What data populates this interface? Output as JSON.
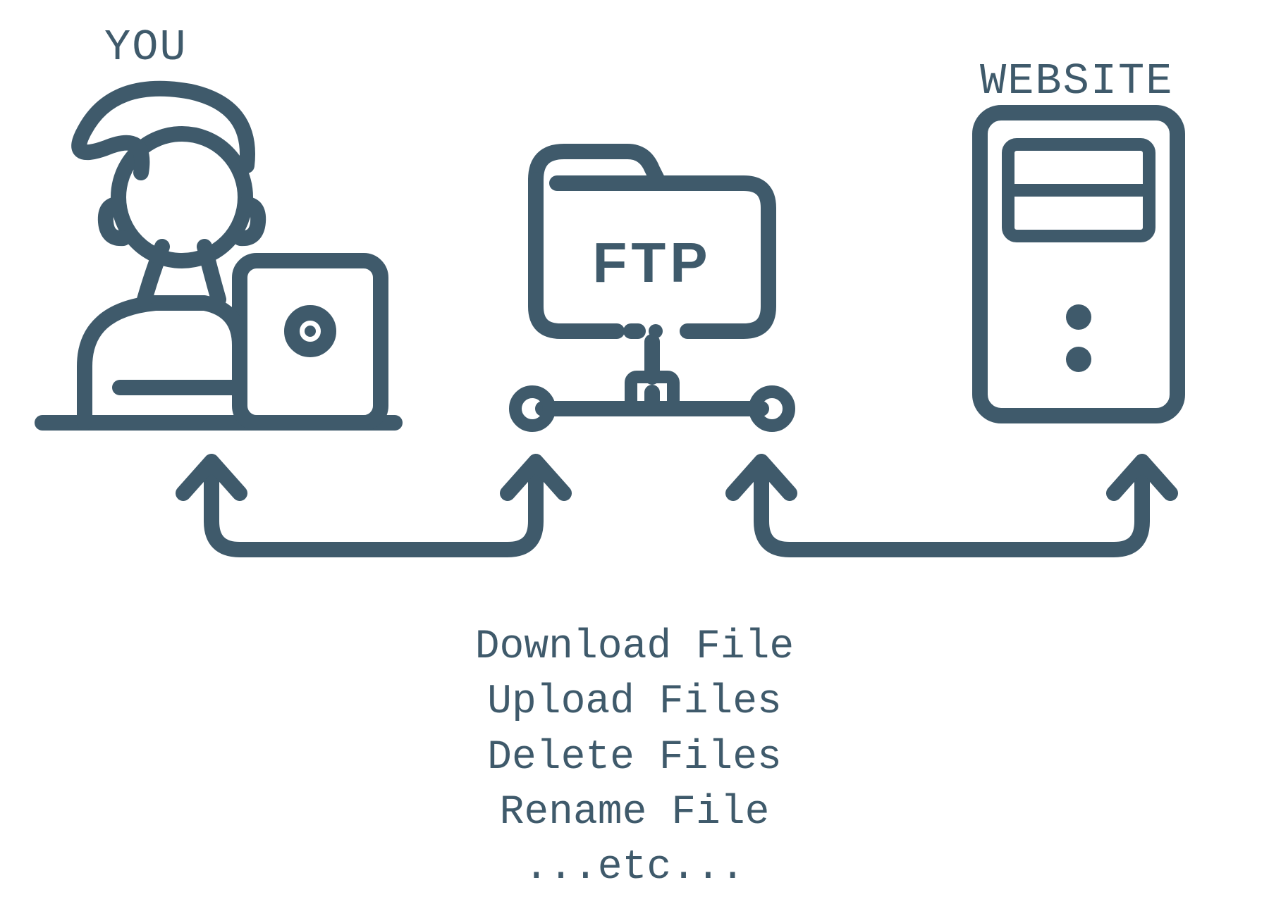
{
  "labels": {
    "you": "YOU",
    "website": "WEBSITE",
    "ftp": "FTP"
  },
  "operations": [
    "Download File",
    "Upload Files",
    "Delete Files",
    "Rename File",
    "...etc..."
  ],
  "colors": {
    "stroke": "#3f5a6b",
    "background": "#ffffff"
  }
}
